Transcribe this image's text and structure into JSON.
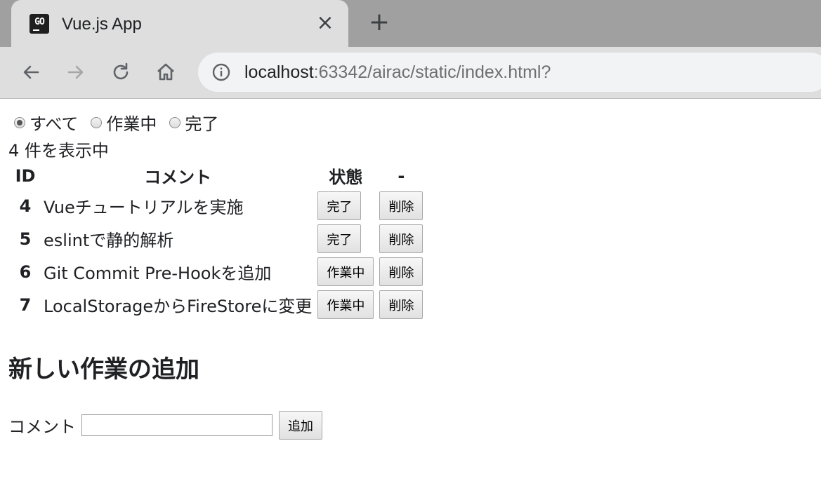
{
  "browser": {
    "tab_title": "Vue.js App",
    "favicon_text": "GO",
    "url_host": "localhost",
    "url_rest": ":63342/airac/static/index.html?"
  },
  "filters": [
    {
      "label": "すべて",
      "checked": true
    },
    {
      "label": "作業中",
      "checked": false
    },
    {
      "label": "完了",
      "checked": false
    }
  ],
  "count_text": "4 件を表示中",
  "table": {
    "headers": [
      "ID",
      "コメント",
      "状態",
      "-"
    ],
    "rows": [
      {
        "id": "4",
        "comment": "Vueチュートリアルを実施",
        "state": "完了",
        "delete": "削除"
      },
      {
        "id": "5",
        "comment": "eslintで静的解析",
        "state": "完了",
        "delete": "削除"
      },
      {
        "id": "6",
        "comment": "Git Commit Pre-Hookを追加",
        "state": "作業中",
        "delete": "削除"
      },
      {
        "id": "7",
        "comment": "LocalStorageからFireStoreに変更",
        "state": "作業中",
        "delete": "削除"
      }
    ]
  },
  "add_section": {
    "title": "新しい作業の追加",
    "label": "コメント",
    "input_value": "",
    "button": "追加"
  }
}
